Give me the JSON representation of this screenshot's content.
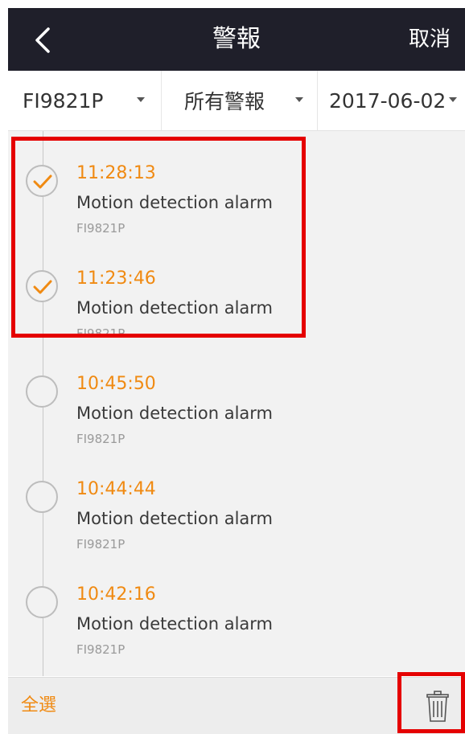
{
  "header": {
    "title": "警報",
    "cancel_label": "取消"
  },
  "filters": {
    "device": "FI9821P",
    "alarm_type": "所有警報",
    "date": "2017-06-02"
  },
  "alarms": [
    {
      "time": "11:28:13",
      "description": "Motion detection alarm",
      "device": "FI9821P",
      "selected": true
    },
    {
      "time": "11:23:46",
      "description": "Motion detection alarm",
      "device": "FI9821P",
      "selected": true
    },
    {
      "time": "10:45:50",
      "description": "Motion detection alarm",
      "device": "FI9821P",
      "selected": false
    },
    {
      "time": "10:44:44",
      "description": "Motion detection alarm",
      "device": "FI9821P",
      "selected": false
    },
    {
      "time": "10:42:16",
      "description": "Motion detection alarm",
      "device": "FI9821P",
      "selected": false
    }
  ],
  "footer": {
    "select_all_label": "全選"
  },
  "colors": {
    "accent": "#f08a12",
    "header_bg": "#1f1f2a",
    "highlight": "#e50000"
  }
}
